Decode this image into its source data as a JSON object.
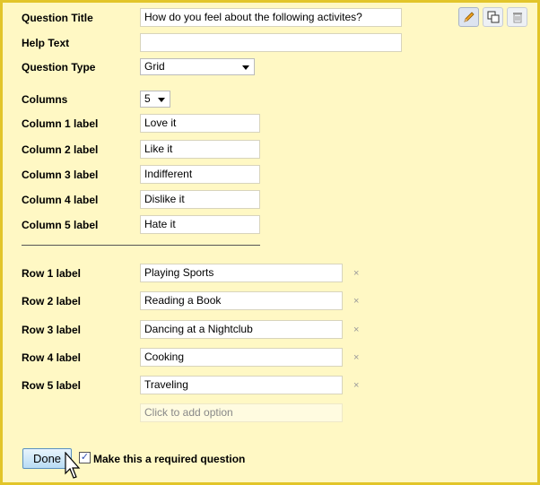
{
  "question_title": {
    "label": "Question Title",
    "value": "How do you feel about the following activites?"
  },
  "help_text": {
    "label": "Help Text",
    "value": ""
  },
  "question_type": {
    "label": "Question Type",
    "value": "Grid"
  },
  "columns": {
    "label": "Columns",
    "value": "5"
  },
  "column_labels": [
    {
      "label": "Column 1 label",
      "value": "Love it"
    },
    {
      "label": "Column 2 label",
      "value": "Like it"
    },
    {
      "label": "Column 3 label",
      "value": "Indifferent"
    },
    {
      "label": "Column 4 label",
      "value": "Dislike it"
    },
    {
      "label": "Column 5 label",
      "value": "Hate it"
    }
  ],
  "row_labels": [
    {
      "label": "Row 1 label",
      "value": "Playing Sports"
    },
    {
      "label": "Row 2 label",
      "value": "Reading a Book"
    },
    {
      "label": "Row 3 label",
      "value": "Dancing at a Nightclub"
    },
    {
      "label": "Row 4 label",
      "value": "Cooking"
    },
    {
      "label": "Row 5 label",
      "value": "Traveling"
    }
  ],
  "remove_glyph": "×",
  "add_option_placeholder": "Click to add option",
  "done_label": "Done",
  "required": {
    "label": "Make this a required question",
    "checked": true
  },
  "toolbar": {
    "icons": [
      "pencil-icon",
      "duplicate-icon",
      "trash-icon"
    ]
  }
}
